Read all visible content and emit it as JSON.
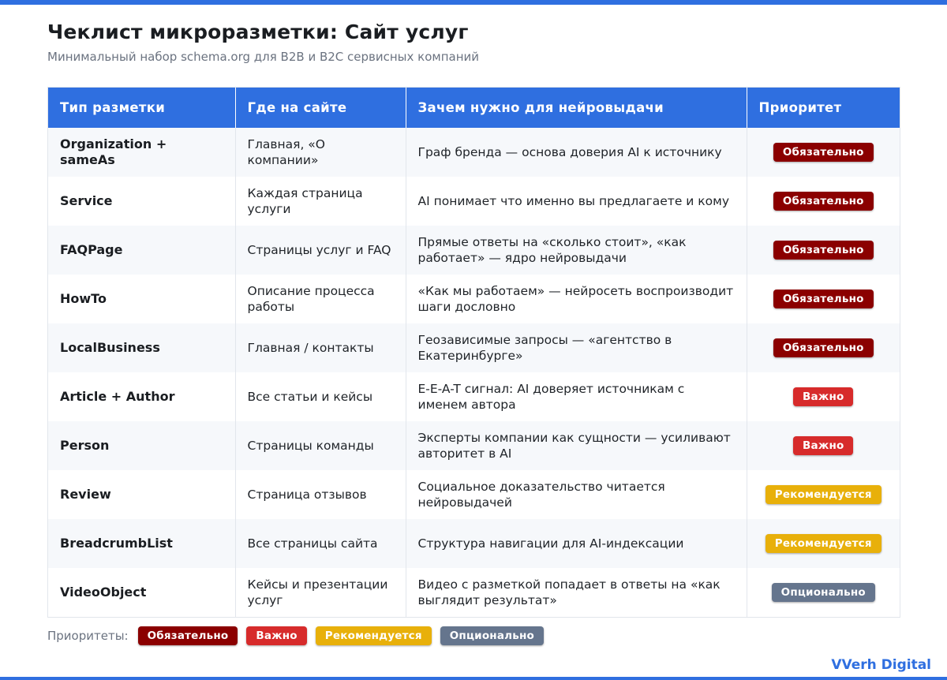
{
  "header": {
    "title": "Чеклист микроразметки: Сайт услуг",
    "subtitle": "Минимальный набор schema.org для B2B и B2C сервисных компаний"
  },
  "table": {
    "columns": [
      "Тип разметки",
      "Где на сайте",
      "Зачем нужно для нейровыдачи",
      "Приоритет"
    ],
    "rows": [
      {
        "type": "Organization + sameAs",
        "where": "Главная, «О компании»",
        "why": "Граф бренда — основа доверия AI к источнику",
        "priority": "Обязательно",
        "level": "mandatory"
      },
      {
        "type": "Service",
        "where": "Каждая страница услуги",
        "why": "AI понимает что именно вы предлагаете и кому",
        "priority": "Обязательно",
        "level": "mandatory"
      },
      {
        "type": "FAQPage",
        "where": "Страницы услуг и FAQ",
        "why": "Прямые ответы на «сколько стоит», «как работает» — ядро нейровыдачи",
        "priority": "Обязательно",
        "level": "mandatory"
      },
      {
        "type": "HowTo",
        "where": "Описание процесса работы",
        "why": "«Как мы работаем» — нейросеть воспроизводит шаги дословно",
        "priority": "Обязательно",
        "level": "mandatory"
      },
      {
        "type": "LocalBusiness",
        "where": "Главная / контакты",
        "why": "Геозависимые запросы — «агентство в Екатеринбурге»",
        "priority": "Обязательно",
        "level": "mandatory"
      },
      {
        "type": "Article + Author",
        "where": "Все статьи и кейсы",
        "why": "E-E-A-T сигнал: AI доверяет источникам с именем автора",
        "priority": "Важно",
        "level": "important"
      },
      {
        "type": "Person",
        "where": "Страницы команды",
        "why": "Эксперты компании как сущности — усиливают авторитет в AI",
        "priority": "Важно",
        "level": "important"
      },
      {
        "type": "Review",
        "where": "Страница отзывов",
        "why": "Социальное доказательство читается нейровыдачей",
        "priority": "Рекомендуется",
        "level": "recommended"
      },
      {
        "type": "BreadcrumbList",
        "where": "Все страницы сайта",
        "why": "Структура навигации для AI-индексации",
        "priority": "Рекомендуется",
        "level": "recommended"
      },
      {
        "type": "VideoObject",
        "where": "Кейсы и презентации услуг",
        "why": "Видео с разметкой попадает в ответы на «как выглядит результат»",
        "priority": "Опционально",
        "level": "optional"
      }
    ]
  },
  "legend": {
    "label": "Приоритеты:",
    "items": [
      {
        "label": "Обязательно",
        "level": "mandatory"
      },
      {
        "label": "Важно",
        "level": "important"
      },
      {
        "label": "Рекомендуется",
        "level": "recommended"
      },
      {
        "label": "Опционально",
        "level": "optional"
      }
    ]
  },
  "footer": {
    "brand": "VVerh Digital"
  },
  "colors": {
    "accent": "#2f6fe0",
    "mandatory": "#8b0000",
    "important": "#d72b2b",
    "recommended": "#e8b00a",
    "optional": "#65758d"
  }
}
